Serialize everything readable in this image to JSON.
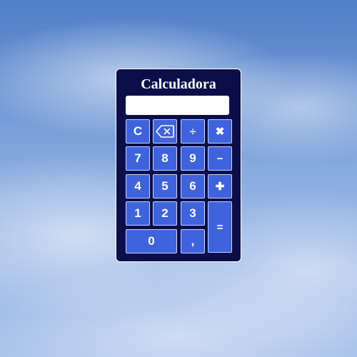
{
  "calculator": {
    "title": "Calculadora",
    "display": {
      "value": ""
    },
    "keys": {
      "clear": "C",
      "backspace_icon": "backspace-icon",
      "divide": "÷",
      "multiply": "✖",
      "seven": "7",
      "eight": "8",
      "nine": "9",
      "subtract": "−",
      "four": "4",
      "five": "5",
      "six": "6",
      "add": "✚",
      "one": "1",
      "two": "2",
      "three": "3",
      "equals": "=",
      "zero": "0",
      "comma": ","
    }
  },
  "colors": {
    "panel_background": "#0c0e49",
    "key_background": "#3e63dd",
    "key_border": "#c7d3ff",
    "text": "#ffffff",
    "display_background": "#ffffff"
  }
}
